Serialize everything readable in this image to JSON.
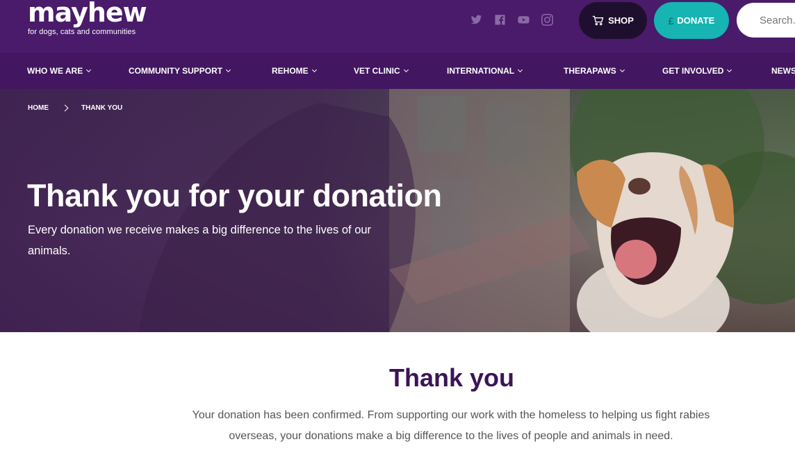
{
  "header": {
    "logo_word": "mayhew",
    "logo_tagline": "for dogs, cats and communities",
    "social_icons": [
      "twitter-icon",
      "facebook-icon",
      "youtube-icon",
      "instagram-icon"
    ],
    "shop_label": "SHOP",
    "donate_currency": "£",
    "donate_label": "DONATE",
    "search_placeholder": "Search..."
  },
  "nav": {
    "items": [
      {
        "label": "WHO WE ARE"
      },
      {
        "label": "COMMUNITY SUPPORT"
      },
      {
        "label": "REHOME"
      },
      {
        "label": "VET CLINIC"
      },
      {
        "label": "INTERNATIONAL"
      },
      {
        "label": "THERAPAWS"
      },
      {
        "label": "GET INVOLVED"
      },
      {
        "label": "NEWS"
      }
    ]
  },
  "hero": {
    "breadcrumb_home": "HOME",
    "breadcrumb_current": "THANK YOU",
    "title": "Thank you for your donation",
    "subtitle": "Every donation we receive makes a big difference to the lives of our animals."
  },
  "content": {
    "heading": "Thank you",
    "body": "Your donation has been confirmed. From supporting our work with the homeless to helping us fight rabies overseas, your donations make a big difference to the lives of people and animals in need."
  },
  "colors": {
    "brand_purple": "#4a1a6b",
    "nav_purple": "#421660",
    "donate_teal": "#16b4b2",
    "shop_dark": "#1f0f2e",
    "heading_purple": "#3b1458"
  }
}
